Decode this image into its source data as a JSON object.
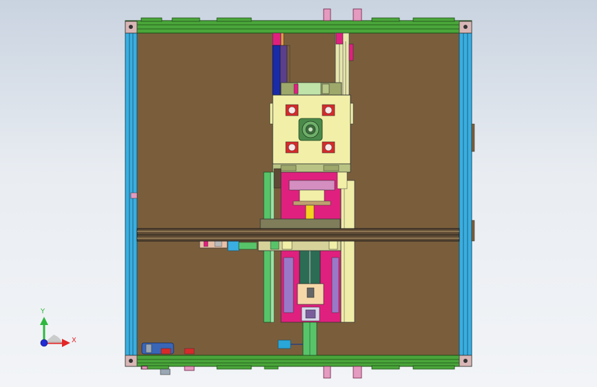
{
  "viewport": {
    "background_top": "#c9d3e0",
    "background_bottom": "#f2f4f7"
  },
  "triad": {
    "x_label": "X",
    "y_label": "Y",
    "x_color": "#e32626",
    "y_color": "#2db83d",
    "z_color": "#1f2bd6"
  },
  "colors": {
    "frame_green": "#3e9a2f",
    "frame_blue": "#2aa6d8",
    "panel_brown": "#7a5e3c",
    "carriage_yellow": "#f2f0a8",
    "magenta": "#e0207e",
    "accent_red": "#d62a2a"
  }
}
